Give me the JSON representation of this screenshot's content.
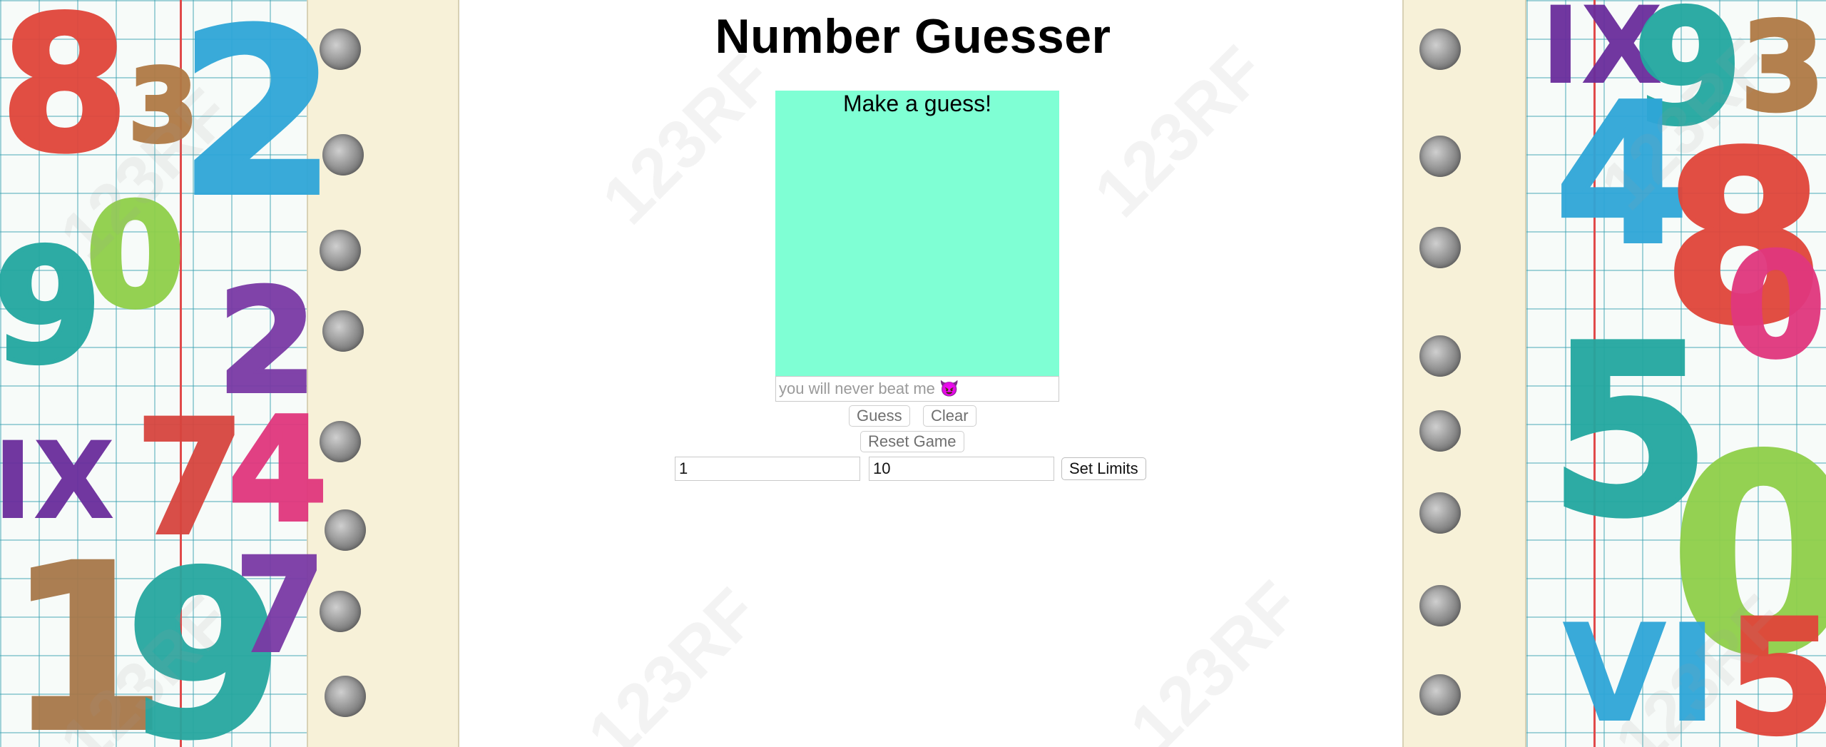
{
  "app": {
    "title": "Number Guesser",
    "display_message": "Make a guess!"
  },
  "guess_form": {
    "guess_placeholder": "you will never beat me 😈",
    "guess_button_label": "Guess",
    "clear_button_label": "Clear",
    "reset_button_label": "Reset Game"
  },
  "limits_form": {
    "min_value": "1",
    "max_value": "10",
    "set_limits_button_label": "Set Limits"
  },
  "background": {
    "watermarks": [
      "123RF",
      "123RF",
      "123RF",
      "123RF",
      "123RF",
      "123RF",
      "123RF",
      "123RF"
    ],
    "left_doodles": [
      "8",
      "3",
      "2",
      "0",
      "9",
      "2",
      "IX",
      "7",
      "4",
      "1",
      "9",
      "7"
    ],
    "right_doodles": [
      "IX",
      "9",
      "4",
      "3",
      "8",
      "0",
      "5",
      "0",
      "VI",
      "5"
    ]
  },
  "colors": {
    "display_box_bg": "#7fffd4",
    "title_color": "#000000",
    "page_bg": "#ffffff"
  }
}
